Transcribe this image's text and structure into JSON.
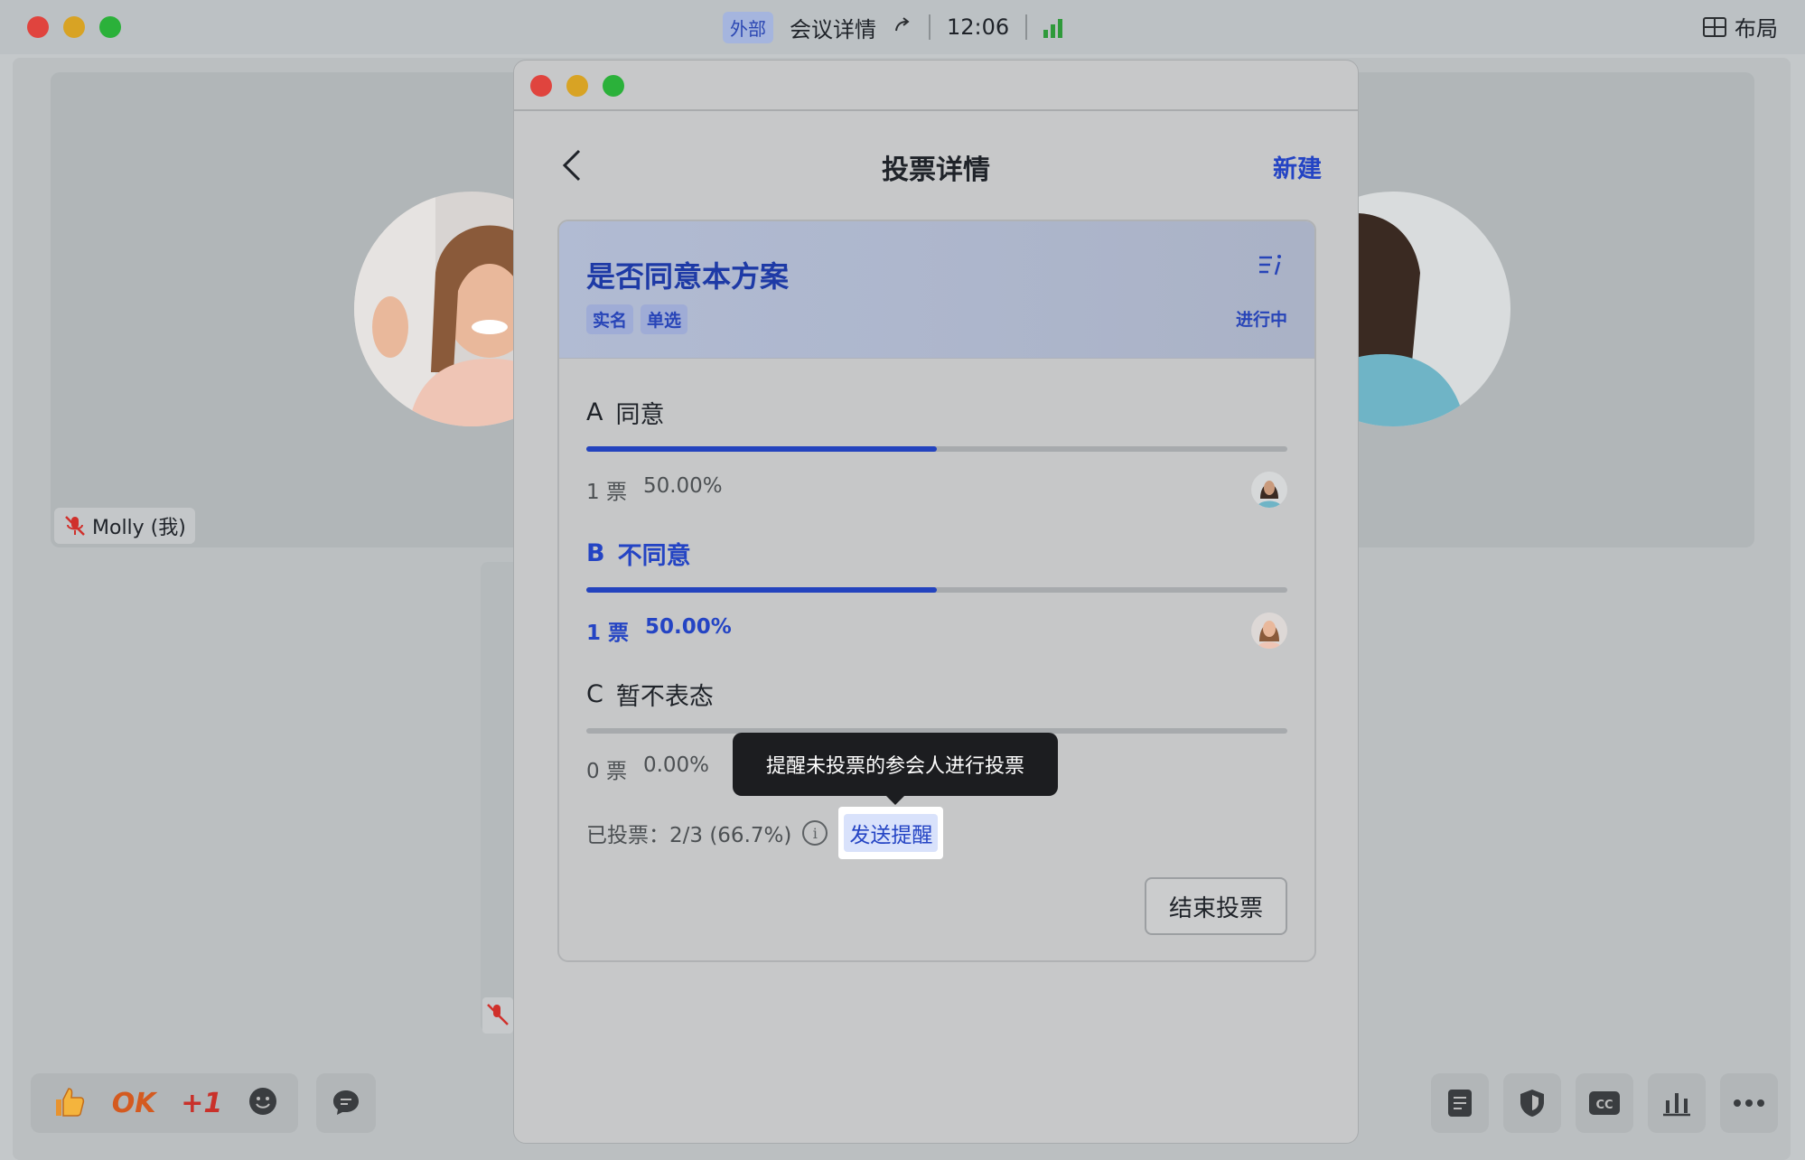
{
  "titlebar": {
    "external_badge": "外部",
    "meeting_title": "会议详情",
    "time": "12:06",
    "layout_label": "布局"
  },
  "participant": {
    "name": "Molly (我)"
  },
  "reactions": {
    "ok": "OK",
    "plus_one": "+1"
  },
  "modal": {
    "title": "投票详情",
    "new_label": "新建",
    "poll": {
      "question": "是否同意本方案",
      "tags": [
        "实名",
        "单选"
      ],
      "status": "进行中",
      "options": [
        {
          "letter": "A",
          "text": "同意",
          "votes": "1 票",
          "percent": "50.00%",
          "fraction": 0.5,
          "selected": false
        },
        {
          "letter": "B",
          "text": "不同意",
          "votes": "1 票",
          "percent": "50.00%",
          "fraction": 0.5,
          "selected": true
        },
        {
          "letter": "C",
          "text": "暂不表态",
          "votes": "0 票",
          "percent": "0.00%",
          "fraction": 0.0,
          "selected": false
        }
      ],
      "voted_summary": "已投票：2/3 (66.7%)",
      "remind_label": "发送提醒",
      "tooltip": "提醒未投票的参会人进行投票",
      "end_label": "结束投票"
    }
  },
  "colors": {
    "accent": "#2444c4",
    "signal": "#2f9a3b"
  }
}
